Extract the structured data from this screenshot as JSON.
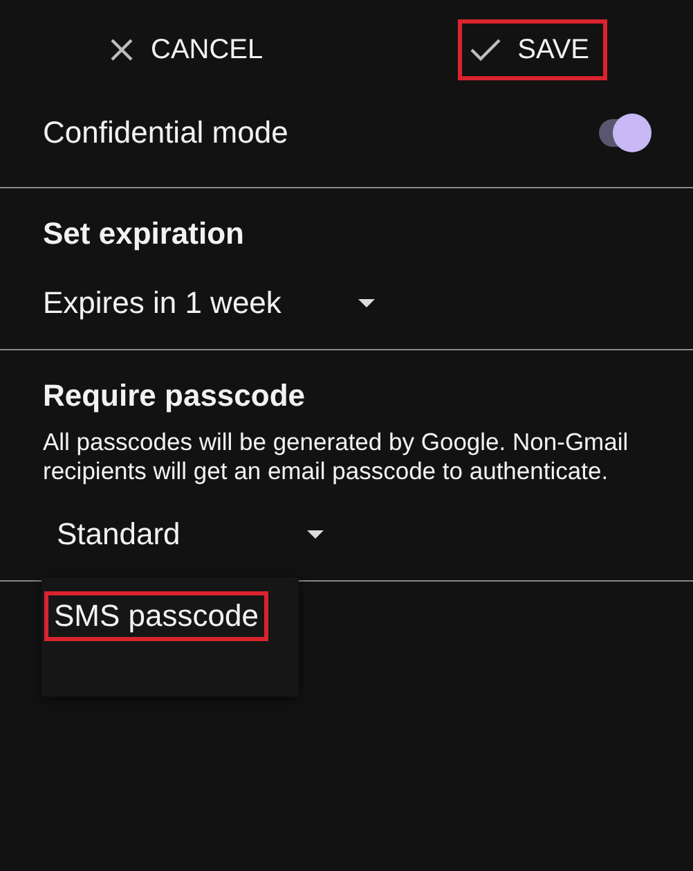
{
  "header": {
    "cancel": {
      "label": "CANCEL",
      "highlighted": false
    },
    "save": {
      "label": "SAVE",
      "highlighted": true
    }
  },
  "confidential_mode": {
    "label": "Confidential mode",
    "on": true
  },
  "expiration": {
    "title": "Set expiration",
    "value": "Expires in 1 week"
  },
  "passcode": {
    "title": "Require passcode",
    "description": "All passcodes will be generated by Google. Non-Gmail recipients will get an email passcode to authenticate.",
    "value": "Standard",
    "menu": [
      {
        "label": "SMS passcode",
        "highlighted": true
      }
    ]
  }
}
